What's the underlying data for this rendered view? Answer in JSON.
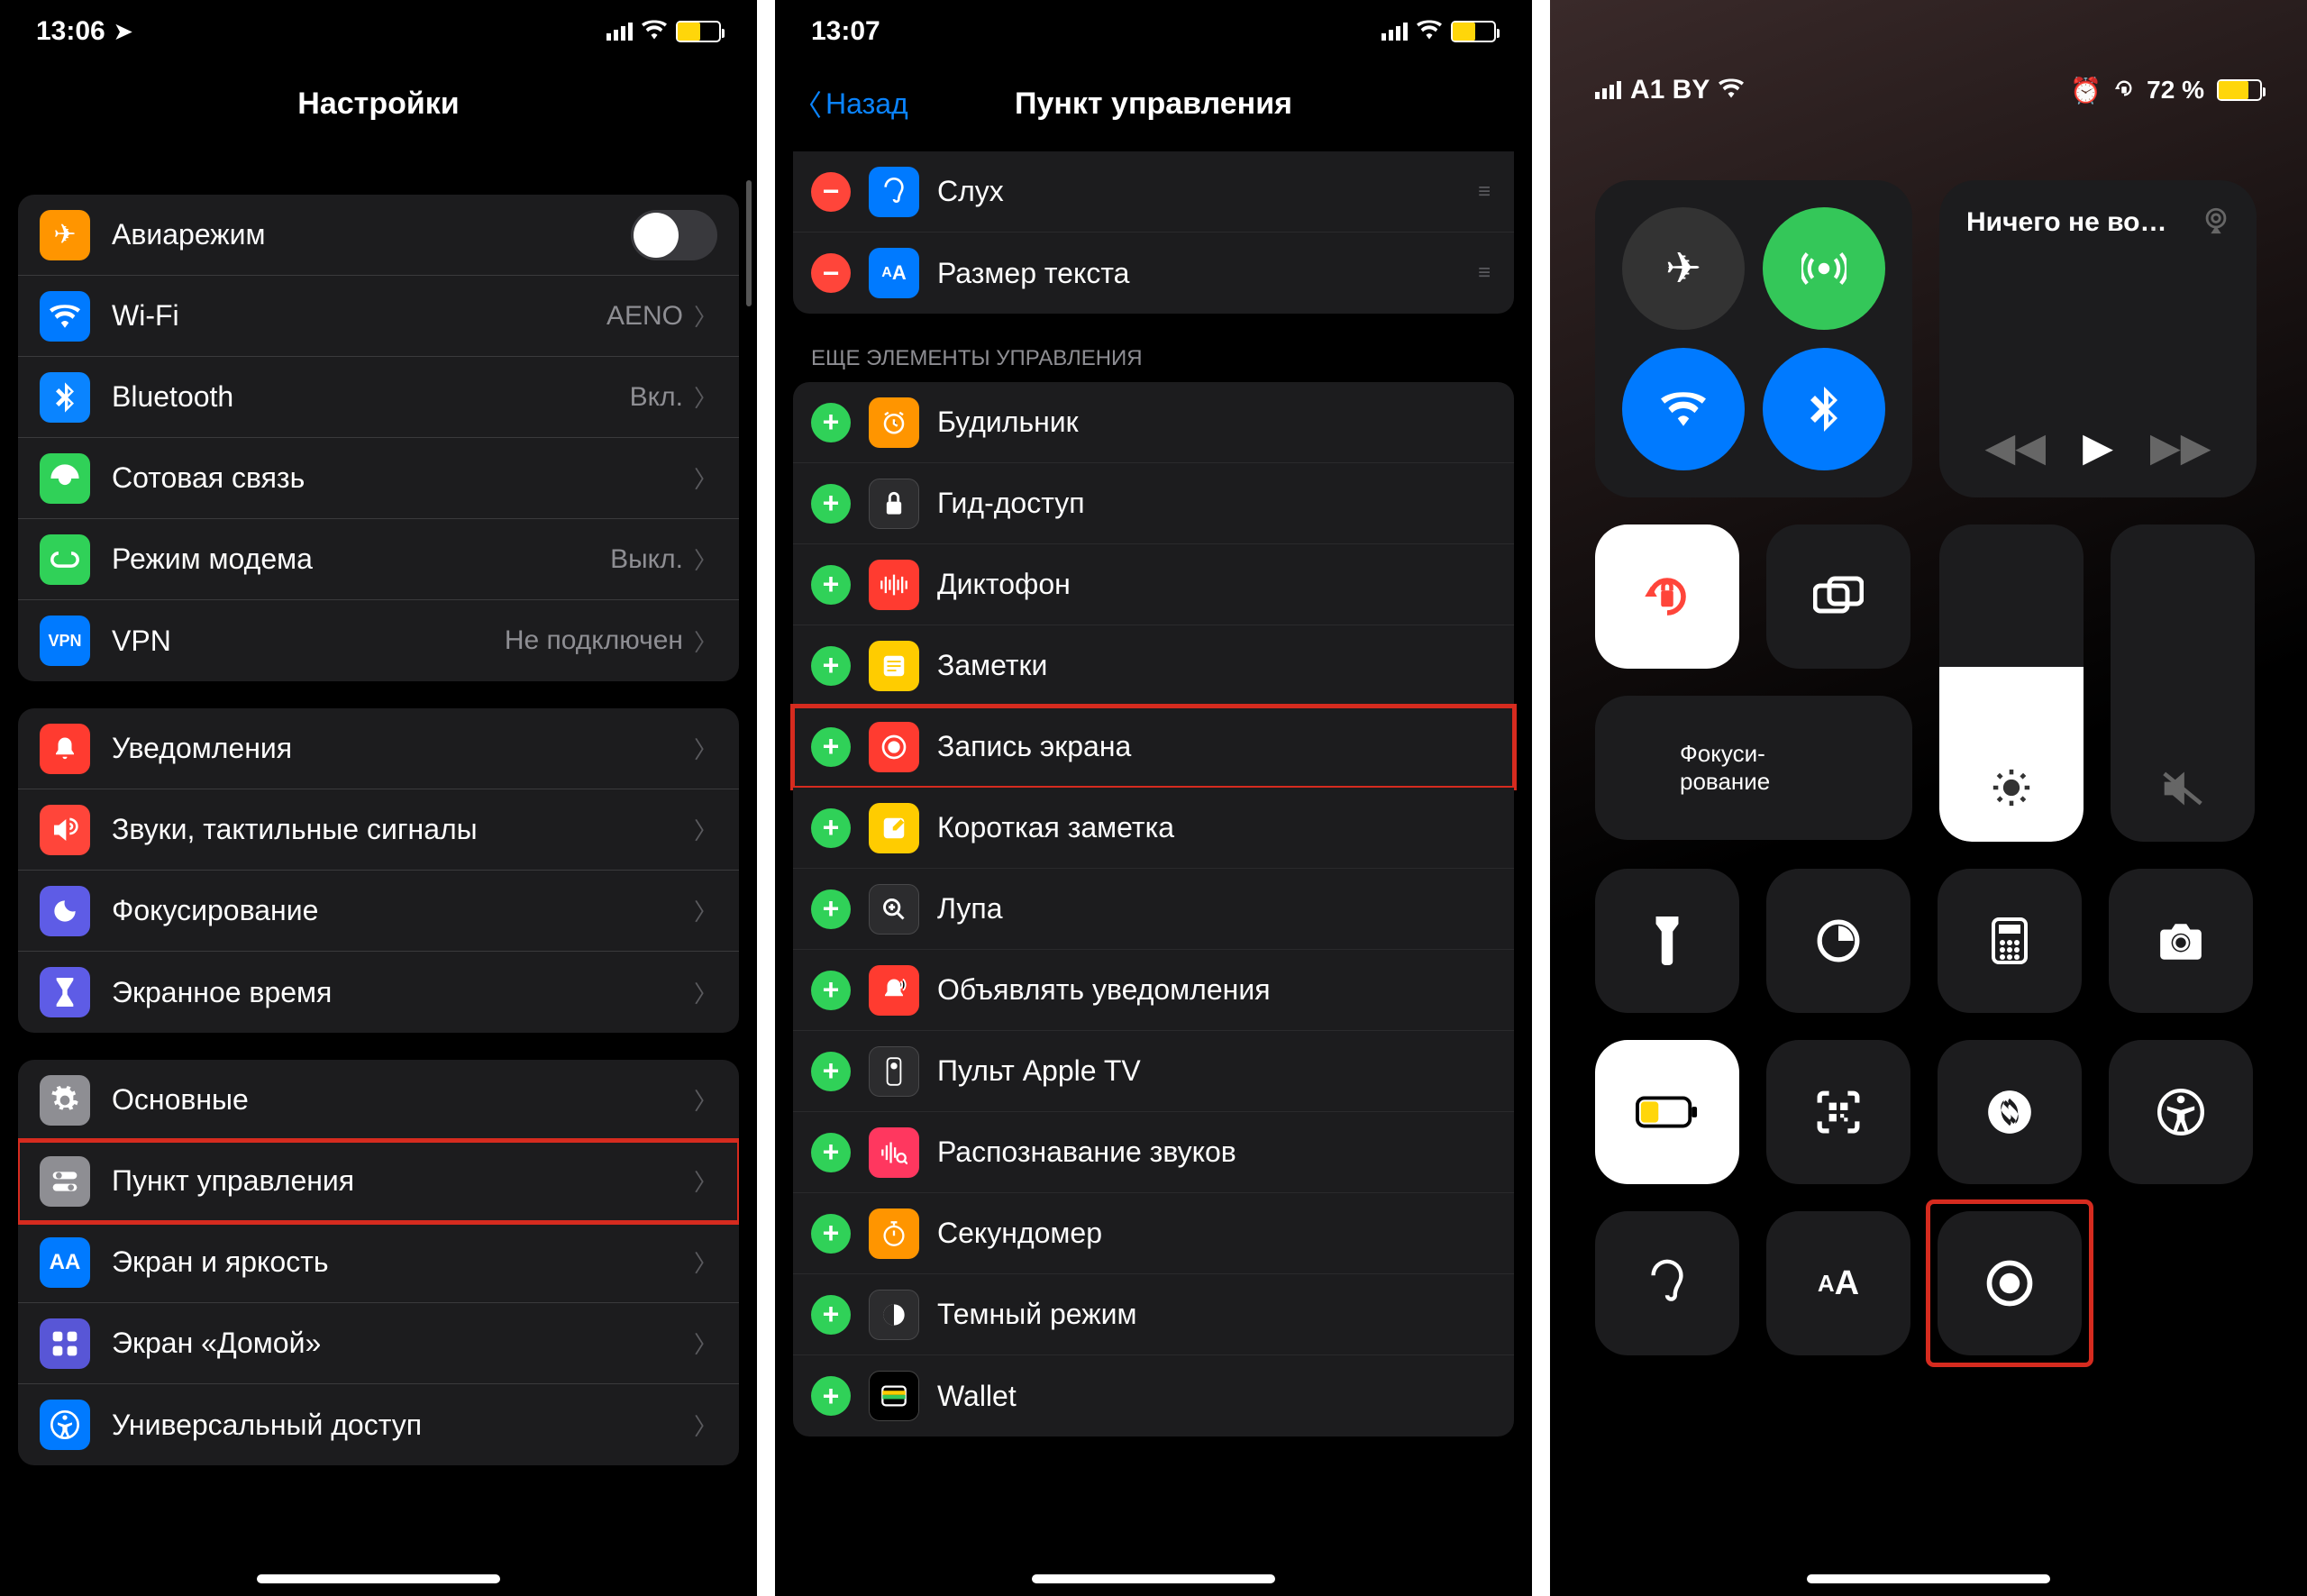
{
  "s1": {
    "time": "13:06",
    "title": "Настройки",
    "g1": [
      {
        "label": "Авиарежим",
        "icon": "✈",
        "bg": "bg-orange",
        "kind": "switch"
      },
      {
        "label": "Wi-Fi",
        "icon": "wifi",
        "bg": "bg-blue",
        "value": "AENO"
      },
      {
        "label": "Bluetooth",
        "icon": "bt",
        "bg": "bg-bt",
        "value": "Вкл."
      },
      {
        "label": "Сотовая связь",
        "icon": "cell",
        "bg": "bg-green",
        "value": ""
      },
      {
        "label": "Режим модема",
        "icon": "link",
        "bg": "bg-green",
        "value": "Выкл."
      },
      {
        "label": "VPN",
        "icon": "VPN",
        "bg": "bg-blue",
        "value": "Не подключен"
      }
    ],
    "g2": [
      {
        "label": "Уведомления",
        "icon": "bell",
        "bg": "bg-red"
      },
      {
        "label": "Звуки, тактильные сигналы",
        "icon": "sound",
        "bg": "bg-red2"
      },
      {
        "label": "Фокусирование",
        "icon": "moon",
        "bg": "bg-purple"
      },
      {
        "label": "Экранное время",
        "icon": "hourglass",
        "bg": "bg-purple"
      }
    ],
    "g3": [
      {
        "label": "Основные",
        "icon": "gear",
        "bg": "bg-gray"
      },
      {
        "label": "Пункт управления",
        "icon": "switches",
        "bg": "bg-gray",
        "highlight": true
      },
      {
        "label": "Экран и яркость",
        "icon": "AA",
        "bg": "bg-blue"
      },
      {
        "label": "Экран «Домой»",
        "icon": "grid",
        "bg": "bg-purpleh"
      },
      {
        "label": "Универсальный доступ",
        "icon": "access",
        "bg": "bg-blue"
      }
    ]
  },
  "s2": {
    "time": "13:07",
    "back": "Назад",
    "title": "Пункт управления",
    "included": [
      {
        "label": "Слух",
        "icon": "ear",
        "bg": "bg-blue"
      },
      {
        "label": "Размер текста",
        "icon": "aA",
        "bg": "bg-blue"
      }
    ],
    "section": "Еще элементы управления",
    "more": [
      {
        "label": "Будильник",
        "icon": "alarm",
        "bg": "bg-orange"
      },
      {
        "label": "Гид-доступ",
        "icon": "lock",
        "bg": "bg-darkgray"
      },
      {
        "label": "Диктофон",
        "icon": "wave",
        "bg": "bg-red"
      },
      {
        "label": "Заметки",
        "icon": "note",
        "bg": "bg-yellow"
      },
      {
        "label": "Запись экрана",
        "icon": "rec",
        "bg": "bg-red",
        "highlight": true
      },
      {
        "label": "Короткая заметка",
        "icon": "qnote",
        "bg": "bg-yellow"
      },
      {
        "label": "Лупа",
        "icon": "mag",
        "bg": "bg-darkgray"
      },
      {
        "label": "Объявлять уведомления",
        "icon": "announce",
        "bg": "bg-red"
      },
      {
        "label": "Пульт Apple TV",
        "icon": "remote",
        "bg": "bg-darkgray"
      },
      {
        "label": "Распознавание звуков",
        "icon": "sr",
        "bg": "bg-pink"
      },
      {
        "label": "Секундомер",
        "icon": "stopw",
        "bg": "bg-orange"
      },
      {
        "label": "Темный режим",
        "icon": "dark",
        "bg": "bg-darkgray"
      },
      {
        "label": "Wallet",
        "icon": "wallet",
        "bg": "bg-black"
      }
    ]
  },
  "s3": {
    "carrier": "A1 BY",
    "battery": "72 %",
    "media": "Ничего не во…",
    "focus": "Фокуси-\nрование"
  }
}
